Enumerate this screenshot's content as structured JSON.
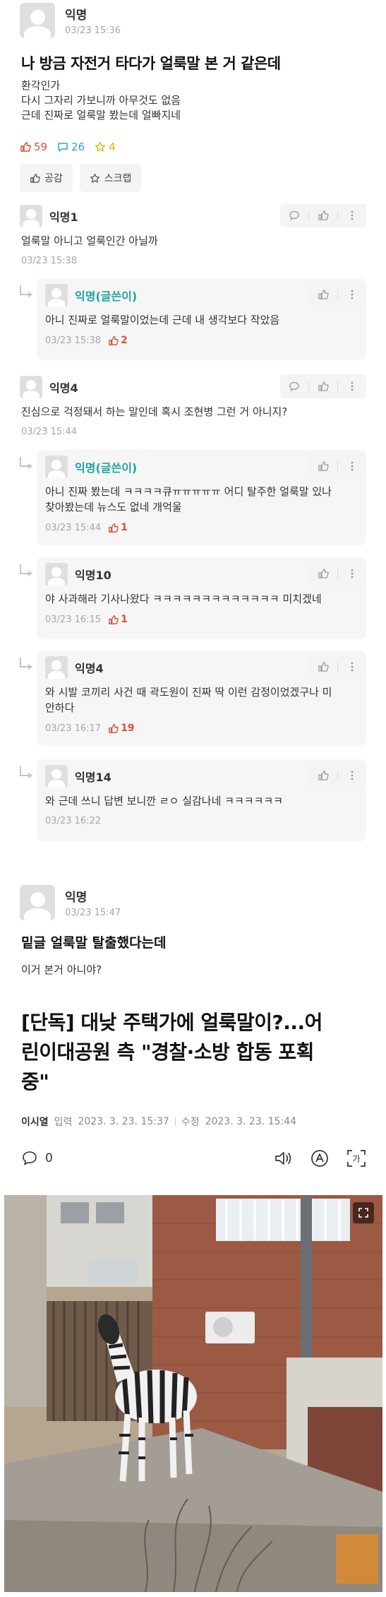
{
  "post": {
    "author": "익명",
    "time": "03/23 15:36",
    "title": "나 방금 자전거 타다가 얼룩말 본 거 같은데",
    "body": "환각인가\n다시 그자리 가보니까 아무것도 없음\n근데 진짜로 얼룩말 봤는데 얼빠지네",
    "likes": "59",
    "comments": "26",
    "scraps": "4",
    "like_button": "공감",
    "scrap_button": "스크랩"
  },
  "comments": [
    {
      "author": "익명1",
      "text": "얼룩말 아니고 얼룩인간 아닐까",
      "time": "03/23 15:38"
    },
    {
      "author": "익명(글쓴이)",
      "text": "아니 진짜로 얼룩말이었는데 근데 내 생각보다 작았음",
      "time": "03/23 15:38",
      "likes": "2"
    },
    {
      "author": "익명4",
      "text": "진심으로 걱정돼서 하는 말인데 혹시 조현병 그런 거 아니지?",
      "time": "03/23 15:44"
    },
    {
      "author": "익명(글쓴이)",
      "text": "아니 진짜 봤는데 ㅋㅋㅋㅋ큐ㅠㅠㅠㅠㅠ 어디 탈주한 얼룩말 있나",
      "text2": "찾아봤는데 뉴스도 없네 개억울",
      "time": "03/23 15:44",
      "likes": "1"
    },
    {
      "author": "익명10",
      "text": "야 사과해라 기사나왔다 ㅋㅋㅋㅋㅋㅋㅋㅋㅋㅋㅋㅋㅋ 미치겠네",
      "time": "03/23 16:15",
      "likes": "1"
    },
    {
      "author": "익명4",
      "text": "와 시발 코끼리 사건 때 곽도원이 진짜 딱 이런 감정이었겠구나 미",
      "text2": "안하다",
      "time": "03/23 16:17",
      "likes": "19"
    },
    {
      "author": "익명14",
      "text": "와 근데 쓰니 답변 보니깐 ㄹㅇ 실감나네 ㅋㅋㅋㅋㅋㅋ",
      "time": "03/23 16:22"
    }
  ],
  "post2": {
    "author": "익명",
    "time": "03/23 15:47",
    "title": "밑글 얼룩말 탈출했다는데",
    "body": "이거 본거 아니야?"
  },
  "news": {
    "title_line1": "[단독] 대낮 주택가에 얼룩말이?...어",
    "title_line2": "린이대공원 측 \"경찰·소방 합동 포획",
    "title_line3": "중\"",
    "reporter": "이시열",
    "input_label": "입력",
    "input_date": "2023. 3. 23. 15:37",
    "edit_label": "수정",
    "edit_date": "2023. 3. 23. 15:44",
    "comment_count": "0",
    "translate_label": "가"
  },
  "colors": {
    "like": "#e0503a",
    "comment": "#2aa5c4",
    "scrap": "#e6b400",
    "writer": "#1fa5a3"
  }
}
